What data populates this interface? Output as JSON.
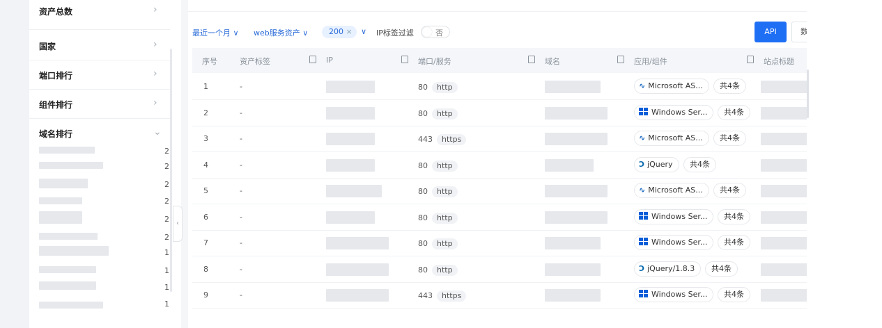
{
  "sidebar": {
    "groups": [
      {
        "label": "资产总数"
      },
      {
        "label": "国家"
      },
      {
        "label": "端口排行"
      },
      {
        "label": "组件排行"
      },
      {
        "label": "域名排行"
      }
    ],
    "domain_counts": [
      "2",
      "2",
      "2",
      "2",
      "2",
      "2",
      "1",
      "1",
      "1",
      "1"
    ]
  },
  "filters": {
    "time": "最近一个月",
    "type": "web服务资产",
    "size": "200",
    "size_clear": "×",
    "ip_filter_label": "IP标签过滤",
    "ip_filter_toggle": "否"
  },
  "buttons": {
    "api": "API",
    "data": "数"
  },
  "table": {
    "headers": [
      "序号",
      "资产标签",
      "IP",
      "端口/服务",
      "域名",
      "应用/组件",
      "站点标题"
    ],
    "rows": [
      {
        "no": "1",
        "tag": "-",
        "port": "80",
        "service": "http",
        "app": "Microsoft AS...",
        "app_icon": "microsoft-asp-icon",
        "count": "共4条"
      },
      {
        "no": "2",
        "tag": "-",
        "port": "80",
        "service": "http",
        "app": "Windows Ser...",
        "app_icon": "windows-icon",
        "count": "共4条"
      },
      {
        "no": "3",
        "tag": "-",
        "port": "443",
        "service": "https",
        "app": "Microsoft AS...",
        "app_icon": "microsoft-asp-icon",
        "count": "共4条"
      },
      {
        "no": "4",
        "tag": "-",
        "port": "80",
        "service": "http",
        "app": "jQuery",
        "app_icon": "jquery-icon",
        "count": "共4条"
      },
      {
        "no": "5",
        "tag": "-",
        "port": "80",
        "service": "http",
        "app": "Microsoft AS...",
        "app_icon": "microsoft-asp-icon",
        "count": "共4条"
      },
      {
        "no": "6",
        "tag": "-",
        "port": "80",
        "service": "http",
        "app": "Windows Ser...",
        "app_icon": "windows-icon",
        "count": "共4条"
      },
      {
        "no": "7",
        "tag": "-",
        "port": "80",
        "service": "http",
        "app": "Windows Ser...",
        "app_icon": "windows-icon",
        "count": "共4条"
      },
      {
        "no": "8",
        "tag": "-",
        "port": "80",
        "service": "http",
        "app": "jQuery/1.8.3",
        "app_icon": "jquery-icon",
        "count": "共4条"
      },
      {
        "no": "9",
        "tag": "-",
        "port": "443",
        "service": "https",
        "app": "Windows Ser...",
        "app_icon": "windows-icon",
        "count": "共4条"
      }
    ]
  },
  "colors": {
    "accent": "#1f6ff5",
    "windows_blue": "#0a5fd8",
    "asp_blue": "#1565c0",
    "jquery_blue": "#0769ad"
  }
}
